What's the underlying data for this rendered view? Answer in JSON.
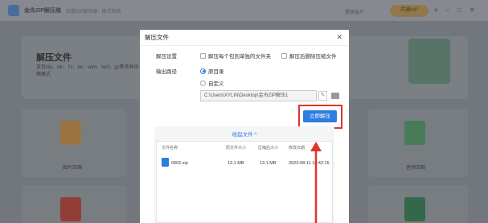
{
  "app": {
    "title": "金舟ZIP解压缩",
    "tagline": "压缩ZIP解压缩 · 格式转换",
    "login": "登录账户",
    "vip": "开通VIP",
    "banner_title": "解压文件",
    "banner_desc": "支持zip、rar、7z、tar、wim、tar2、gz等多种压缩格式",
    "cards": [
      "图片压缩",
      "音频压缩"
    ]
  },
  "dialog": {
    "title": "解压文件",
    "settings_label": "解压设置",
    "option1": "解压每个包到单独的文件夹",
    "option2": "解压后删除压缩文件",
    "output_label": "输出路径",
    "radio_original": "原目录",
    "radio_custom": "自定义",
    "path_value": "C:\\Users\\XYLIN\\Desktop\\金舟ZIP解压1",
    "extract_button": "立即解压",
    "collapse_label": "收起文件 ^",
    "table": {
      "headers": [
        "文件名称",
        "原文件大小",
        "压缩后大小",
        "修改日期"
      ],
      "rows": [
        {
          "name": "0002.zip",
          "orig": "13.1 MB",
          "comp": "13.1 MB",
          "date": "2023-08-11 10:42:15"
        }
      ]
    }
  },
  "colors": {
    "accent": "#2e7de1",
    "highlight": "#e0342b"
  }
}
